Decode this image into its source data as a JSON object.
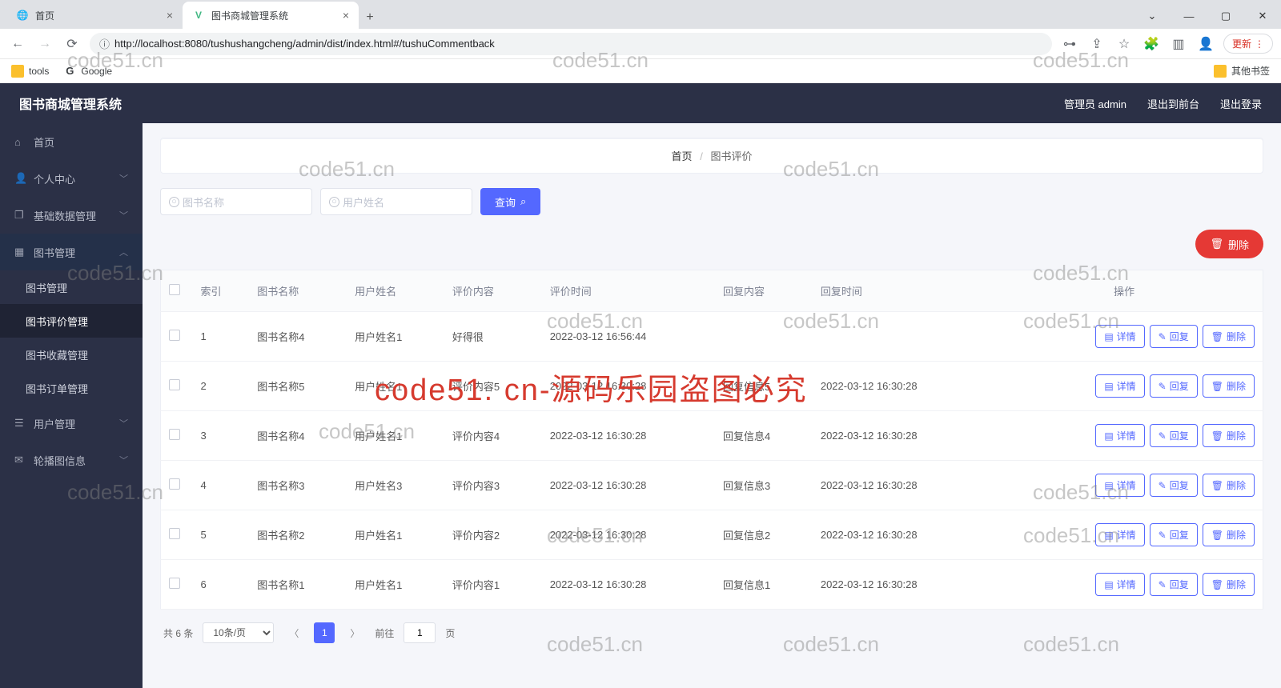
{
  "browser": {
    "tabs": [
      {
        "title": "首页",
        "favicon": "🌐"
      },
      {
        "title": "图书商城管理系统",
        "favicon": "V"
      }
    ],
    "url_info": "ⓘ",
    "url": "http://localhost:8080/tushushangcheng/admin/dist/index.html#/tushuCommentback",
    "bookmarks": {
      "tools": "tools",
      "google": "Google",
      "other": "其他书签"
    },
    "update": "更新",
    "win": {
      "min": "—",
      "max": "▢",
      "close": "✕",
      "drop": "⌄"
    }
  },
  "header": {
    "title": "图书商城管理系统",
    "admin": "管理员 admin",
    "front": "退出到前台",
    "logout": "退出登录"
  },
  "sidebar": {
    "home": "首页",
    "personal": "个人中心",
    "basedata": "基础数据管理",
    "book": "图书管理",
    "subs": {
      "manage": "图书管理",
      "comment": "图书评价管理",
      "fav": "图书收藏管理",
      "order": "图书订单管理"
    },
    "user": "用户管理",
    "carousel": "轮播图信息"
  },
  "crumb": {
    "home": "首页",
    "current": "图书评价"
  },
  "filters": {
    "book_ph": "图书名称",
    "user_ph": "用户姓名",
    "search": "查询"
  },
  "toolbar": {
    "delete": "删除"
  },
  "table": {
    "headers": {
      "idx": "索引",
      "book": "图书名称",
      "user": "用户姓名",
      "content": "评价内容",
      "time": "评价时间",
      "reply": "回复内容",
      "rtime": "回复时间",
      "ops": "操作"
    },
    "ops": {
      "detail": "详情",
      "reply": "回复",
      "del": "删除"
    },
    "rows": [
      {
        "idx": "1",
        "book": "图书名称4",
        "user": "用户姓名1",
        "content": "好得很",
        "time": "2022-03-12 16:56:44",
        "reply": "",
        "rtime": ""
      },
      {
        "idx": "2",
        "book": "图书名称5",
        "user": "用户姓名1",
        "content": "评价内容5",
        "time": "2022-03-12 16:30:28",
        "reply": "回复信息5",
        "rtime": "2022-03-12 16:30:28"
      },
      {
        "idx": "3",
        "book": "图书名称4",
        "user": "用户姓名1",
        "content": "评价内容4",
        "time": "2022-03-12 16:30:28",
        "reply": "回复信息4",
        "rtime": "2022-03-12 16:30:28"
      },
      {
        "idx": "4",
        "book": "图书名称3",
        "user": "用户姓名3",
        "content": "评价内容3",
        "time": "2022-03-12 16:30:28",
        "reply": "回复信息3",
        "rtime": "2022-03-12 16:30:28"
      },
      {
        "idx": "5",
        "book": "图书名称2",
        "user": "用户姓名1",
        "content": "评价内容2",
        "time": "2022-03-12 16:30:28",
        "reply": "回复信息2",
        "rtime": "2022-03-12 16:30:28"
      },
      {
        "idx": "6",
        "book": "图书名称1",
        "user": "用户姓名1",
        "content": "评价内容1",
        "time": "2022-03-12 16:30:28",
        "reply": "回复信息1",
        "rtime": "2022-03-12 16:30:28"
      }
    ]
  },
  "pager": {
    "total": "共 6 条",
    "perpage": "10条/页",
    "goto": "前往",
    "page": "1",
    "unit": "页"
  },
  "watermark": {
    "small": "code51.cn",
    "big": "code51. cn-源码乐园盗图必究"
  }
}
